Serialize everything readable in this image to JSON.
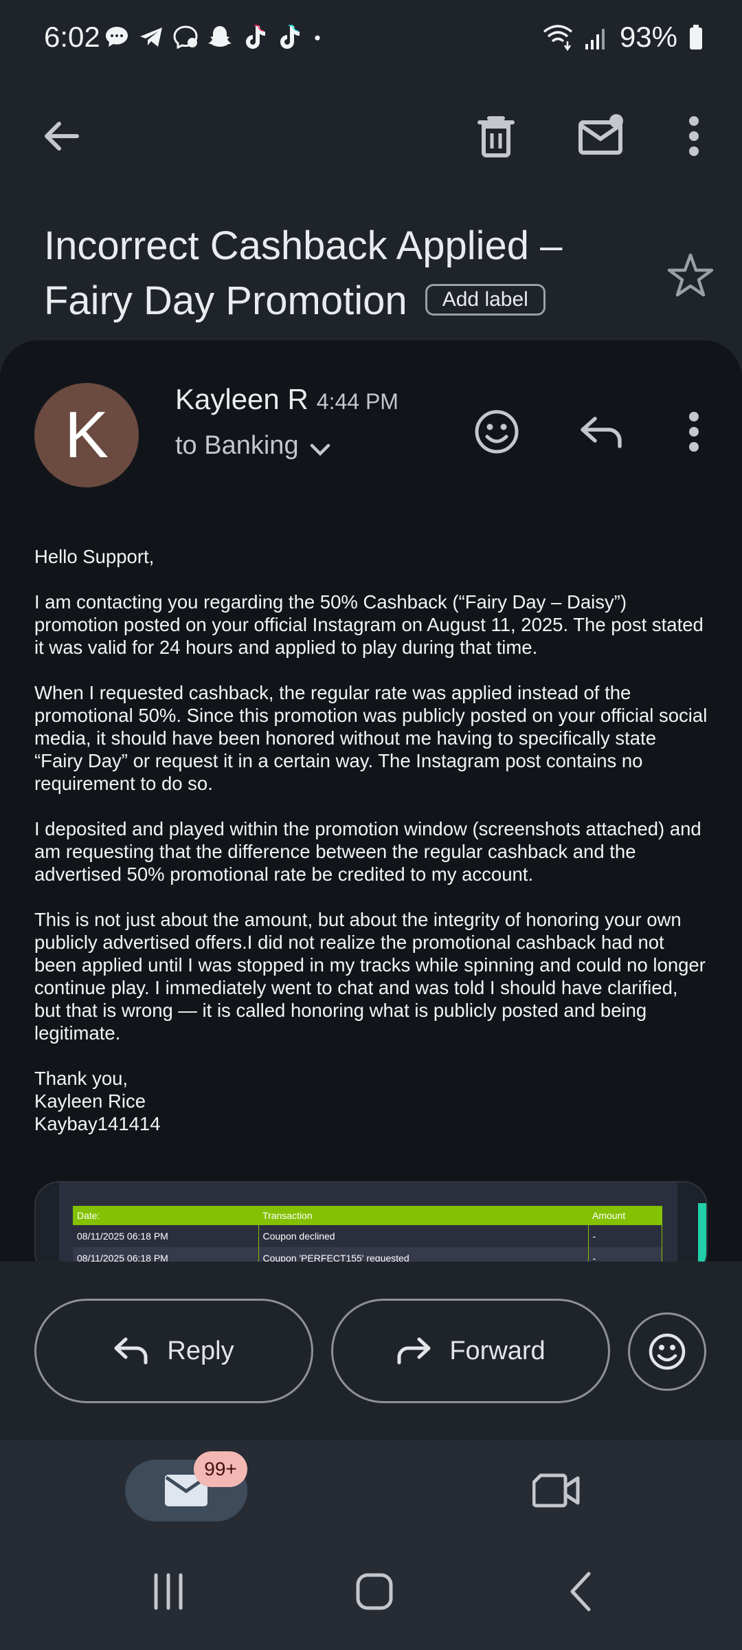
{
  "status_bar": {
    "time": "6:02",
    "battery": "93%",
    "notification_icons": [
      "messages-icon",
      "telegram-icon",
      "messenger-icon",
      "snapchat-icon",
      "tiktok-icon",
      "tiktok-icon",
      "dot-icon"
    ]
  },
  "toolbar": {
    "icons": [
      "back-arrow-icon",
      "delete-icon",
      "mark-unread-icon",
      "more-vert-icon"
    ]
  },
  "subject": {
    "title": "Incorrect Cashback Applied – Fairy Day Promotion",
    "label_chip": "Add label"
  },
  "message": {
    "avatar_letter": "K",
    "avatar_color": "#6b4a40",
    "sender": "Kayleen R",
    "time": "4:44 PM",
    "recipient": "to Banking",
    "body": [
      "Hello Support,",
      "I am contacting you regarding the 50% Cashback (“Fairy Day – Daisy”) promotion posted on your official Instagram on August 11, 2025. The post stated it was valid for 24 hours and applied to play during that time.",
      "When I requested cashback, the regular rate was applied instead of the promotional 50%. Since this promotion was publicly posted on your official social media, it should have been honored without me having to specifically state “Fairy Day” or request it in a certain way. The Instagram post contains no requirement to do so.",
      "I deposited and played within the promotion window (screenshots attached) and am requesting that the difference between the regular cashback and the advertised 50% promotional rate be credited to my account.",
      "This is not just about the amount, but about the integrity of honoring your own publicly advertised offers.I did not realize the promotional cashback had not been applied until I was stopped in my tracks while spinning and could no longer continue play. I immediately went to chat and was told I should have clarified, but that is wrong — it is called honoring what is publicly posted and being legitimate."
    ],
    "signoff": [
      "Thank you,",
      "Kayleen Rice",
      "Kaybay141414"
    ]
  },
  "attachment": {
    "headers": [
      "Date:",
      "Transaction",
      "Amount"
    ],
    "rows": [
      [
        "08/11/2025 06:18 PM",
        "Coupon declined",
        "-"
      ],
      [
        "08/11/2025 06:18 PM",
        "Coupon 'PERFECT155' requested",
        "-"
      ]
    ],
    "header_color": "#84c104"
  },
  "actions": {
    "reply": "Reply",
    "forward": "Forward"
  },
  "bottom_nav": {
    "mail_badge": "99+"
  }
}
